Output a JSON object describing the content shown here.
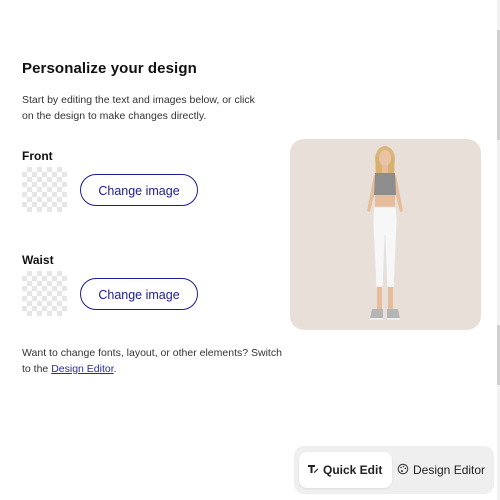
{
  "personalize": {
    "title": "Personalize your design",
    "description": "Start by editing the text and images below, or click on the design to make changes directly."
  },
  "sections": [
    {
      "label": "Front",
      "button_label": "Change image"
    },
    {
      "label": "Waist",
      "button_label": "Change image"
    }
  ],
  "footer": {
    "prefix": "Want to change fonts, layout, or other elements? Switch to the ",
    "link": "Design Editor",
    "suffix": "."
  },
  "mode_switch": {
    "quick_edit": "Quick Edit",
    "design_editor": "Design Editor"
  },
  "colors": {
    "accent": "#1d1d8f",
    "preview_bg": "#e8e0d8"
  },
  "icons": {
    "quick_edit": "quick-edit-icon",
    "design_editor": "palette-icon"
  }
}
